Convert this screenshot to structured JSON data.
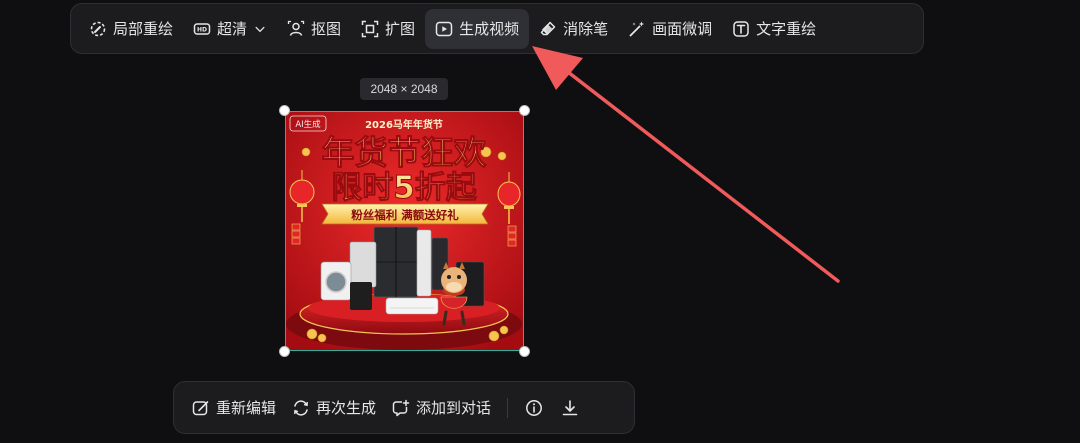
{
  "toolbar": {
    "items": [
      {
        "label": "局部重绘",
        "icon": "brush-circle-icon"
      },
      {
        "label": "超清",
        "icon": "hd-icon"
      },
      {
        "label": "抠图",
        "icon": "person-cutout-icon"
      },
      {
        "label": "扩图",
        "icon": "expand-icon"
      },
      {
        "label": "生成视频",
        "icon": "play-icon",
        "active": true
      },
      {
        "label": "消除笔",
        "icon": "eraser-icon"
      },
      {
        "label": "画面微调",
        "icon": "magic-wand-icon"
      },
      {
        "label": "文字重绘",
        "icon": "text-box-icon"
      }
    ]
  },
  "image": {
    "size_label": "2048 × 2048",
    "poster": {
      "badge": "AI生成",
      "header": "2026马年年货节",
      "title_line1": "年货节狂欢",
      "title_line2": "限时5折起",
      "ribbon": "粉丝福利 满额送好礼"
    }
  },
  "bottom_bar": {
    "reedit_label": "重新编辑",
    "regenerate_label": "再次生成",
    "add_to_chat_label": "添加到对话"
  },
  "colors": {
    "accent_arrow": "#f05a5a",
    "selection_border": "#2bb0a0",
    "poster_red": "#c4151c",
    "poster_gold": "#ffd76a"
  }
}
